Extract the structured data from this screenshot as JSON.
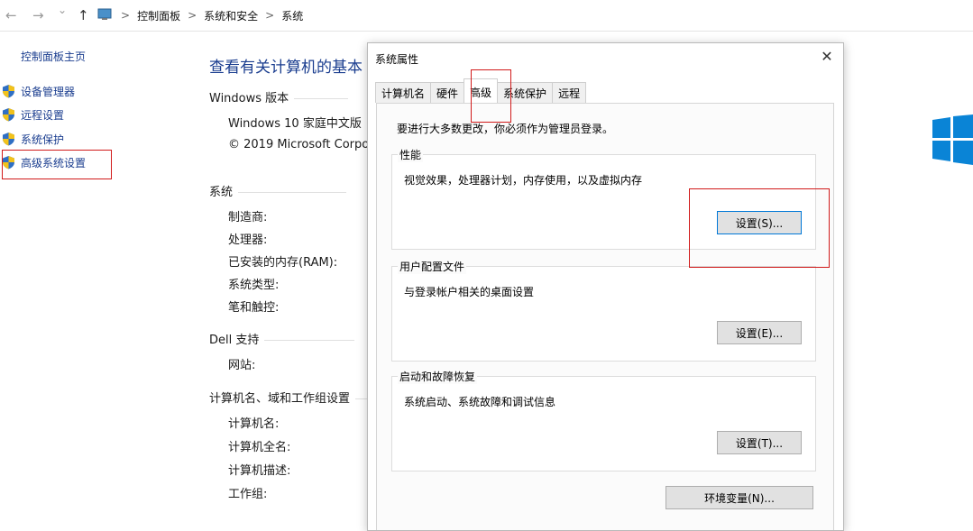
{
  "nav": {
    "back_icon": "←",
    "forward_icon": "→",
    "dropdown_icon": "⌄",
    "up_icon": "↑"
  },
  "breadcrumb": {
    "items": [
      "控制面板",
      "系统和安全",
      "系统"
    ],
    "separator": ">"
  },
  "sidebar": {
    "home": "控制面板主页",
    "items": [
      {
        "label": "设备管理器"
      },
      {
        "label": "远程设置"
      },
      {
        "label": "系统保护"
      },
      {
        "label": "高级系统设置"
      }
    ]
  },
  "main": {
    "heading": "查看有关计算机的基本",
    "windows_section": "Windows 版本",
    "windows_edition": "Windows 10 家庭中文版",
    "copyright": "© 2019 Microsoft Corpo",
    "system_section": "系统",
    "system_rows": [
      "制造商:",
      "处理器:",
      "已安装的内存(RAM):",
      "系统类型:",
      "笔和触控:"
    ],
    "dell_section": "Dell 支持",
    "dell_rows": [
      "网站:"
    ],
    "computer_section": "计算机名、域和工作组设置",
    "computer_rows": [
      "计算机名:",
      "计算机全名:",
      "计算机描述:",
      "工作组:"
    ]
  },
  "dialog": {
    "title": "系统属性",
    "close_icon": "✕",
    "tabs": [
      "计算机名",
      "硬件",
      "高级",
      "系统保护",
      "远程"
    ],
    "active_tab": "高级",
    "admin_note": "要进行大多数更改，你必须作为管理员登录。",
    "performance": {
      "title": "性能",
      "desc": "视觉效果，处理器计划，内存使用，以及虚拟内存",
      "button": "设置(S)..."
    },
    "profiles": {
      "title": "用户配置文件",
      "desc": "与登录帐户相关的桌面设置",
      "button": "设置(E)..."
    },
    "startup": {
      "title": "启动和故障恢复",
      "desc": "系统启动、系统故障和调试信息",
      "button": "设置(T)..."
    },
    "env_button": "环境变量(N)..."
  },
  "colors": {
    "link": "#1a3d8f",
    "highlight_red": "#d11a1a",
    "win_blue": "#0a84d6",
    "default_button_border": "#0078d7"
  }
}
